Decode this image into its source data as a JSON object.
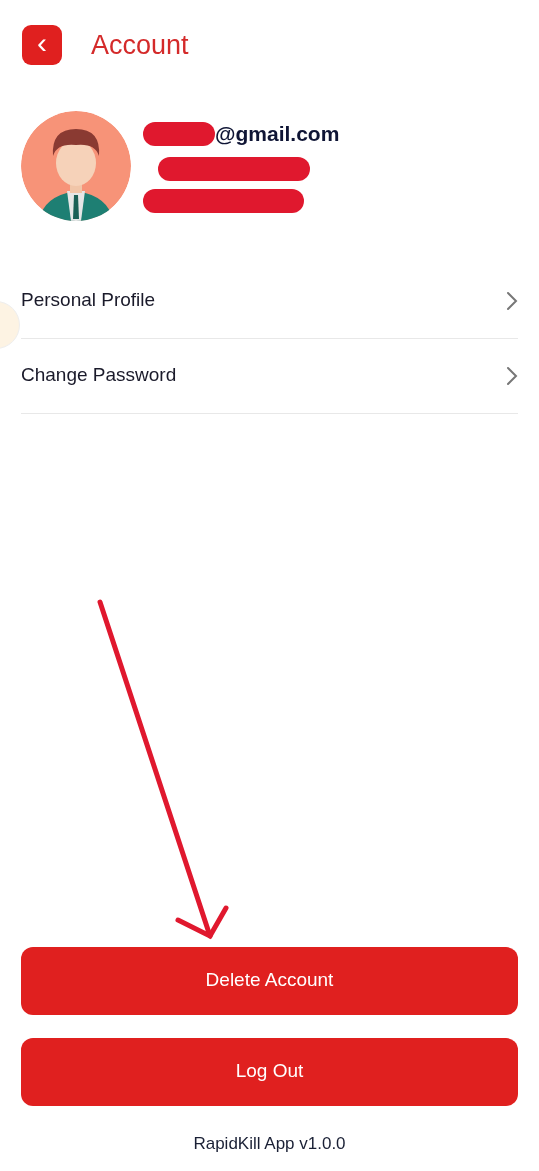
{
  "header": {
    "back_icon": "‹",
    "title": "Account"
  },
  "profile": {
    "email": "@gmail.com"
  },
  "menu_items": [
    {
      "label": "Personal Profile"
    },
    {
      "label": "Change Password"
    }
  ],
  "buttons": [
    {
      "label": "Delete Account"
    },
    {
      "label": "Log Out"
    }
  ],
  "footer": "RapidKill App v1.0.0"
}
